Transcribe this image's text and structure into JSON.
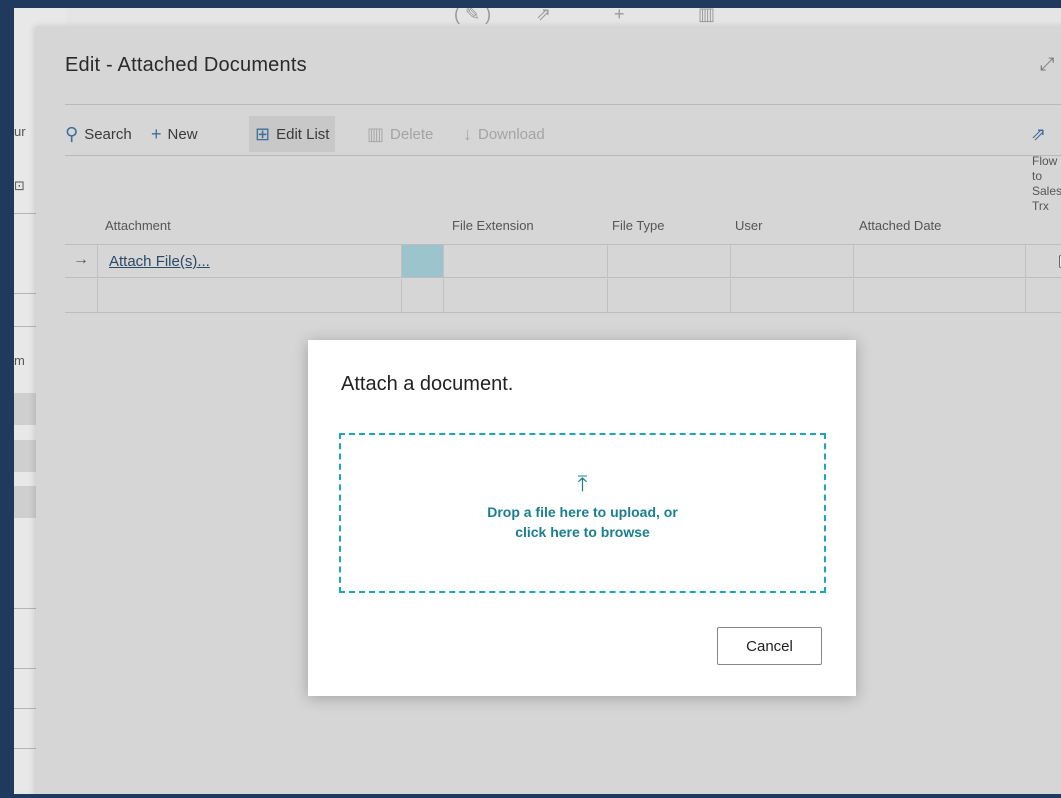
{
  "background": {
    "toolbar_icons": [
      "edit-icon",
      "share-icon",
      "add-icon",
      "delete-icon"
    ],
    "left_fragments": [
      "ur",
      "m"
    ]
  },
  "panel": {
    "title": "Edit - Attached Documents",
    "toolbar": {
      "search": "Search",
      "new": "New",
      "edit_list": "Edit List",
      "delete": "Delete",
      "download": "Download"
    },
    "table": {
      "headers": {
        "attachment": "Attachment",
        "file_extension": "File Extension",
        "file_type": "File Type",
        "user": "User",
        "attached_date": "Attached Date",
        "flow_to_sales_trx": [
          "Flow",
          "to",
          "Sales",
          "Trx"
        ]
      },
      "rows": [
        {
          "attachment": "Attach File(s)...",
          "file_extension": "",
          "file_type": "",
          "user": "",
          "attached_date": "",
          "flow_checked": false
        },
        {
          "attachment": "",
          "file_extension": "",
          "file_type": "",
          "user": "",
          "attached_date": ""
        }
      ]
    }
  },
  "dialog": {
    "title": "Attach a document.",
    "drop_line1": "Drop a file here to upload, or",
    "drop_line2": "click here to browse",
    "cancel": "Cancel"
  },
  "colors": {
    "accent": "#1aa7b8",
    "accent_text": "#1a7f8e",
    "selected_cell": "#9cc4cc",
    "frame_border": "#1f3a5c"
  }
}
